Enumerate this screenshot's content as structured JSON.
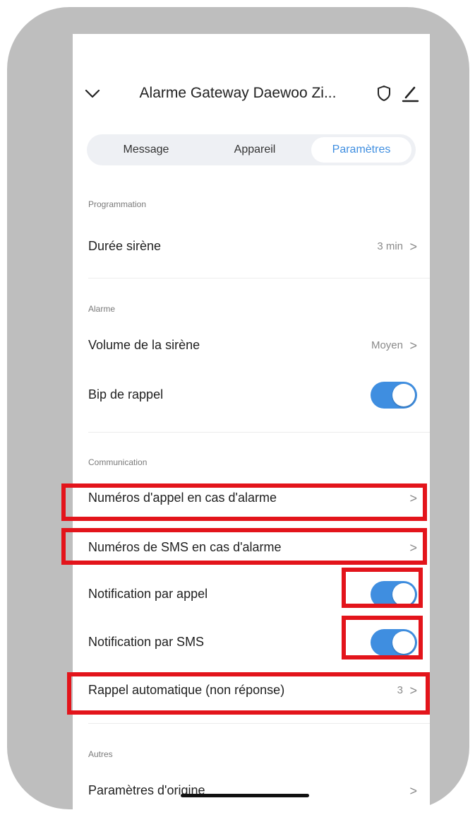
{
  "header": {
    "title": "Alarme Gateway Daewoo Zi...",
    "back_icon": "chevron-down-icon",
    "shield_icon": "shield-icon",
    "edit_icon": "pencil-icon"
  },
  "tabs": [
    {
      "label": "Message",
      "active": false
    },
    {
      "label": "Appareil",
      "active": false
    },
    {
      "label": "Paramètres",
      "active": true
    }
  ],
  "sections": {
    "programmation": {
      "label": "Programmation",
      "rows": [
        {
          "label": "Durée sirène",
          "value": "3 min",
          "arrow": ">"
        }
      ]
    },
    "alarme": {
      "label": "Alarme",
      "rows": [
        {
          "label": "Volume de la sirène",
          "value": "Moyen",
          "arrow": ">"
        },
        {
          "label": "Bip de rappel",
          "toggle": true
        }
      ]
    },
    "communication": {
      "label": "Communication",
      "rows": [
        {
          "label": "Numéros d'appel en cas d'alarme",
          "arrow": ">"
        },
        {
          "label": "Numéros de SMS en cas d'alarme",
          "arrow": ">"
        },
        {
          "label": "Notification par appel",
          "toggle": true
        },
        {
          "label": "Notification par SMS",
          "toggle": true
        },
        {
          "label": "Rappel automatique (non réponse)",
          "value": "3",
          "arrow": ">"
        }
      ]
    },
    "autres": {
      "label": "Autres",
      "rows": [
        {
          "label": "Paramètres d'origine",
          "arrow": ">"
        }
      ]
    }
  },
  "colors": {
    "accent": "#3f8ee0",
    "highlight": "#e3141b",
    "frame": "#bebebe"
  }
}
